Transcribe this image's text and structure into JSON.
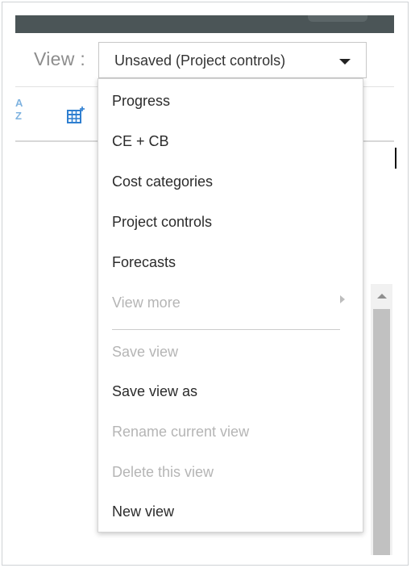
{
  "view_label": "View :",
  "select": {
    "value": "Unsaved (Project controls)"
  },
  "toolbar": {
    "sort_letter_a": "A",
    "sort_letter_z": "Z"
  },
  "menu": {
    "items": [
      {
        "label": "Progress",
        "enabled": true
      },
      {
        "label": "CE + CB",
        "enabled": true
      },
      {
        "label": "Cost categories",
        "enabled": true
      },
      {
        "label": "Project controls",
        "enabled": true
      },
      {
        "label": "Forecasts",
        "enabled": true
      },
      {
        "label": "View more",
        "enabled": false
      },
      {
        "label": "Save view",
        "enabled": false
      },
      {
        "label": "Save view as",
        "enabled": true
      },
      {
        "label": "Rename current view",
        "enabled": false
      },
      {
        "label": "Delete this view",
        "enabled": false
      },
      {
        "label": "New view",
        "enabled": true
      }
    ]
  },
  "colors": {
    "topbar": "#4b5557",
    "accent_icon": "#2f7fd0",
    "disabled_text": "#b5b5b5"
  },
  "icons": [
    "caret-down-icon",
    "sort-az-icon",
    "table-icon",
    "chevron-right-icon",
    "scroll-up-icon"
  ]
}
